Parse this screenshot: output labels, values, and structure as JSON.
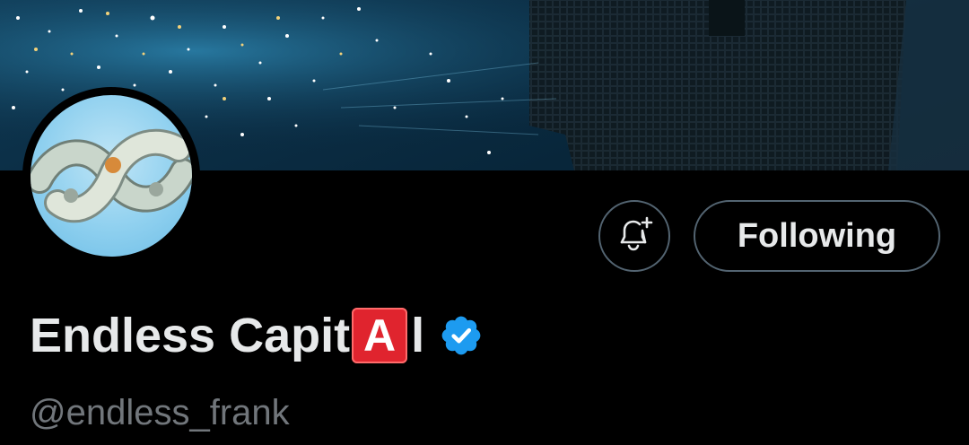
{
  "profile": {
    "name_part1": "Endless Capit",
    "name_emoji_letter": "A",
    "name_part2": "l",
    "handle": "@endless_frank",
    "verified": true
  },
  "actions": {
    "notify_icon": "bell-plus-icon",
    "follow_label": "Following"
  },
  "colors": {
    "background": "#000000",
    "text_primary": "#e7e9ea",
    "text_secondary": "#71767b",
    "border": "#536471",
    "verified_badge": "#1d9bf0",
    "emoji_red": "#e0242e"
  }
}
